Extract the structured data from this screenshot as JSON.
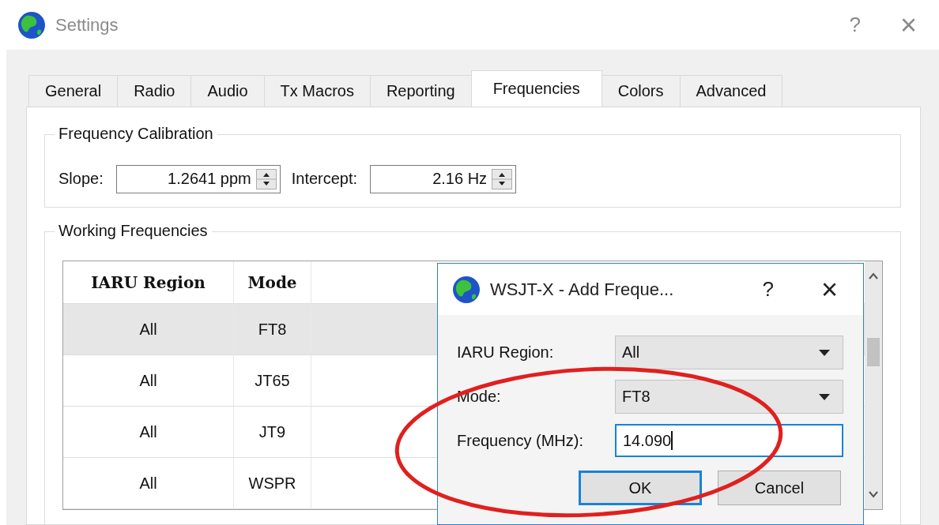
{
  "window": {
    "title": "Settings",
    "help": "?",
    "close": "×"
  },
  "tabs": [
    {
      "label": "General",
      "selected": false
    },
    {
      "label": "Radio",
      "selected": false
    },
    {
      "label": "Audio",
      "selected": false
    },
    {
      "label": "Tx Macros",
      "selected": false
    },
    {
      "label": "Reporting",
      "selected": false
    },
    {
      "label": "Frequencies",
      "selected": true
    },
    {
      "label": "Colors",
      "selected": false
    },
    {
      "label": "Advanced",
      "selected": false
    }
  ],
  "frequency_calibration": {
    "title": "Frequency Calibration",
    "fields": [
      {
        "label": "Slope:",
        "value": "1.2641 ppm"
      },
      {
        "label": "Intercept:",
        "value": "2.16 Hz"
      }
    ]
  },
  "working_frequencies": {
    "title": "Working Frequencies",
    "table": {
      "columns": [
        "IARU Region",
        "Mode"
      ],
      "rows": [
        {
          "region": "All",
          "mode": "FT8",
          "selected": true
        },
        {
          "region": "All",
          "mode": "JT65",
          "selected": false
        },
        {
          "region": "All",
          "mode": "JT9",
          "selected": false
        },
        {
          "region": "All",
          "mode": "WSPR",
          "selected": false
        }
      ]
    }
  },
  "dialog": {
    "title": "WSJT-X - Add Freque...",
    "help": "?",
    "close": "×",
    "fields": [
      {
        "kind": "combo",
        "label": "IARU Region:",
        "value": "All"
      },
      {
        "kind": "combo",
        "label": "Mode:",
        "value": "FT8"
      },
      {
        "kind": "input",
        "label": "Frequency (MHz):",
        "value": "14.090",
        "focused": true
      }
    ],
    "buttons": [
      {
        "label": "OK",
        "default": true
      },
      {
        "label": "Cancel",
        "default": false
      }
    ]
  },
  "annotation": {
    "kind": "ellipse"
  }
}
